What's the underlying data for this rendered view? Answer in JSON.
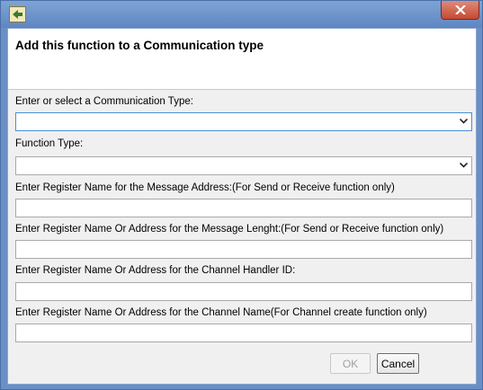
{
  "dialog": {
    "header_title": "Add this function to a Communication type",
    "buttons": {
      "ok": "OK",
      "cancel": "Cancel"
    }
  },
  "fields": {
    "communication_type": {
      "label": "Enter or select a Communication Type:",
      "value": ""
    },
    "function_type": {
      "label": "Function Type:",
      "value": ""
    },
    "message_address": {
      "label": "Enter Register Name for the Message Address:(For Send or Receive function only)",
      "value": ""
    },
    "message_length": {
      "label": "Enter Register Name Or Address for the Message Lenght:(For Send or Receive function only)",
      "value": ""
    },
    "channel_handler_id": {
      "label": "Enter Register Name Or Address for the Channel Handler ID:",
      "value": ""
    },
    "channel_name": {
      "label": "Enter Register Name Or Address for the Channel Name(For Channel create function only)",
      "value": ""
    }
  },
  "icons": {
    "app": "app-icon",
    "close": "close-icon",
    "dropdown": "chevron-down-icon"
  },
  "colors": {
    "title_bar": "#6a8fc4",
    "close_button": "#c44a32",
    "focus_border": "#4a8fd6"
  }
}
